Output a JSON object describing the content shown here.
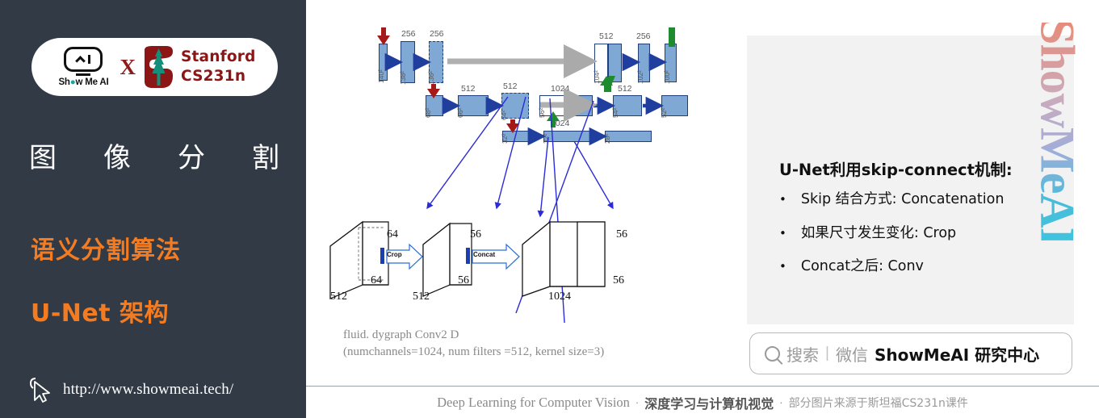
{
  "colors": {
    "sidebar_bg": "#323a45",
    "accent_orange": "#F47B20",
    "stanford_red": "#8C1515",
    "panel_bg": "#f2f2f2",
    "block_blue": "#7FA8D4",
    "block_border": "#1F3E7A",
    "arrow_blue": "#2b2bd8",
    "down_arrow_red": "#A51919",
    "up_arrow_green": "#1E8C2E"
  },
  "sidebar": {
    "logo": {
      "showmeai_text": "Show Me AI",
      "cross": "X",
      "stanford_line1": "Stanford",
      "stanford_line2": "CS231n"
    },
    "title_chars": [
      "图",
      "像",
      "分",
      "割"
    ],
    "subtitle_1": "语义分割算法",
    "subtitle_2": "U-Net 架构",
    "url": "http://www.showmeai.tech/"
  },
  "diagram": {
    "top_labels": [
      "256",
      "256",
      "512",
      "512",
      "1024",
      "1024",
      "512",
      "512",
      "256"
    ],
    "encoder_blocks": [
      {
        "size": "140²",
        "channels": ""
      },
      {
        "size": "138²",
        "channels": "256"
      },
      {
        "size": "136²",
        "channels": "256"
      },
      {
        "size": "68²",
        "channels": ""
      },
      {
        "size": "66²",
        "channels": "512"
      },
      {
        "size": "64²",
        "channels": "512"
      },
      {
        "size": "32²",
        "channels": ""
      },
      {
        "size": "30²",
        "channels": "1024"
      },
      {
        "size": "28²",
        "channels": ""
      }
    ],
    "decoder_blocks": [
      {
        "size": "56²",
        "channels": "1024"
      },
      {
        "size": "54²",
        "channels": "512"
      },
      {
        "size": "52²",
        "channels": ""
      },
      {
        "size": "104²",
        "channels": "512"
      },
      {
        "size": "102²",
        "channels": "256"
      },
      {
        "size": "100²",
        "channels": ""
      }
    ],
    "boxes_3d": [
      {
        "depth": "512",
        "height": "64",
        "width": "64"
      },
      {
        "depth": "512",
        "height": "56",
        "width": "56"
      },
      {
        "depth": "1024",
        "height": "56",
        "width": "56"
      }
    ],
    "op_labels": [
      "Crop",
      "Concat"
    ],
    "caption_line1": "fluid. dygraph Conv2 D",
    "caption_line2": "(numchannels=1024, num  filters =512, kernel  size=3)"
  },
  "info_panel": {
    "title": "U-Net利用skip-connect机制:",
    "bullets": [
      "Skip 结合方式: Concatenation",
      "如果尺寸发生变化: Crop",
      "Concat之后: Conv"
    ],
    "bullet_marker": "•"
  },
  "watermark": {
    "text": "ShowMeAI"
  },
  "search_box": {
    "placeholder_cn": "搜索",
    "divider": "|",
    "channel": "微信",
    "brand": "ShowMeAI 研究中心"
  },
  "footer": {
    "english": "Deep Learning for Computer Vision",
    "sep1": "·",
    "chinese_bold": "深度学习与计算机视觉",
    "sep2": "·",
    "chinese_small": "部分图片来源于斯坦福CS231n课件"
  }
}
